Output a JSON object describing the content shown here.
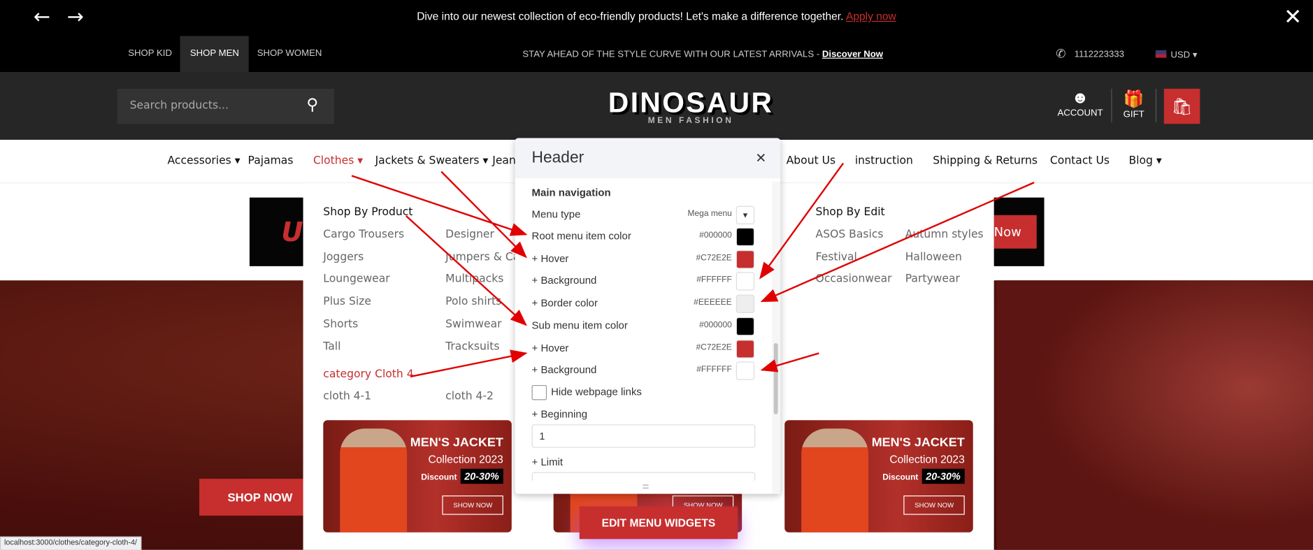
{
  "announcement": {
    "text": "Dive into our newest collection of eco-friendly products! Let's make a difference together.",
    "link": "Apply now"
  },
  "topbar": {
    "tabs": [
      "SHOP KID",
      "SHOP MEN",
      "SHOP WOMEN"
    ],
    "active_tab": "SHOP MEN",
    "promo": "STAY AHEAD OF THE STYLE CURVE WITH OUR LATEST ARRIVALS - ",
    "promo_link": "Discover Now",
    "phone": "1112223333",
    "currency": "USD"
  },
  "header": {
    "search_placeholder": "Search products...",
    "logo": "DINOSAUR",
    "logo_sub": "MEN FASHION",
    "account": "ACCOUNT",
    "gift": "GIFT"
  },
  "nav": {
    "items": [
      "Accessories",
      "Pajamas",
      "Clothes",
      "Jackets & Sweaters",
      "Jean",
      "About Us",
      "instruction",
      "Shipping & Returns",
      "Contact Us",
      "Blog"
    ],
    "active": "Clothes"
  },
  "mega": {
    "col1_title": "Shop By Product",
    "col1": [
      "Cargo Trousers",
      "Joggers",
      "Loungewear",
      "Plus Size",
      "Shorts",
      "Tall"
    ],
    "col2": [
      "Designer",
      "Jumpers & Car",
      "Multipacks",
      "Polo shirts",
      "Swimwear",
      "Tracksuits"
    ],
    "category": "category Cloth 4",
    "cat_items": [
      "cloth 4-1",
      "cloth 4-2"
    ],
    "edit_title": "Shop By Edit",
    "edit1": [
      "ASOS Basics",
      "Festival",
      "Occasionwear"
    ],
    "edit2": [
      "Autumn styles",
      "Halloween",
      "Partywear"
    ],
    "card": {
      "title": "MEN'S JACKET",
      "subtitle": "Collection 2023",
      "discount_label": "Discount",
      "discount": "20-30%",
      "button": "SHOW NOW"
    }
  },
  "hero": {
    "shop_now": "SHOP NOW",
    "banner_button": "Now",
    "banner_text": "U"
  },
  "panel": {
    "title": "Header",
    "section": "Main navigation",
    "menu_type_label": "Menu type",
    "menu_type": "Mega menu",
    "rows": [
      {
        "label": "Root menu item color",
        "value": "#000000"
      },
      {
        "label": "+ Hover",
        "value": "#C72E2E"
      },
      {
        "label": "+ Background",
        "value": "#FFFFFF"
      },
      {
        "label": "+ Border color",
        "value": "#EEEEEE"
      },
      {
        "label": "Sub menu item color",
        "value": "#000000"
      },
      {
        "label": "+ Hover",
        "value": "#C72E2E"
      },
      {
        "label": "+ Background",
        "value": "#FFFFFF"
      }
    ],
    "hide_links": "Hide webpage links",
    "hide_links_checked": false,
    "beginning_label": "+ Beginning",
    "beginning": "1",
    "limit_label": "+ Limit",
    "limit": ""
  },
  "edit_widgets": "EDIT MENU WIDGETS",
  "status_url": "localhost:3000/clothes/category-cloth-4/",
  "colors": {
    "accent": "#C72E2E",
    "annotation": "#E00000"
  }
}
